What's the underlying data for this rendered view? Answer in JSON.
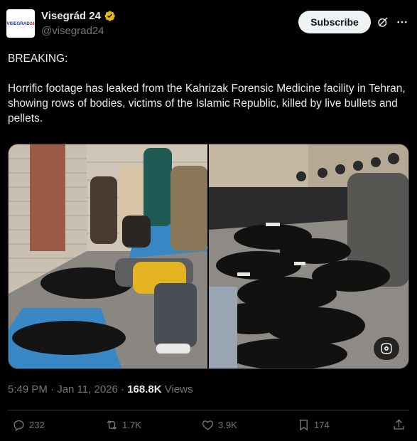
{
  "author": {
    "avatar_text_1": "VISEGRAD",
    "avatar_text_2": "24",
    "display_name": "Visegrád 24",
    "handle": "@visegrad24",
    "verified": true
  },
  "header": {
    "subscribe_label": "Subscribe",
    "grok_icon": "grok-icon",
    "more_icon": "more-icon"
  },
  "tweet": {
    "text": "BREAKING:\n\nHorrific footage has leaked from the Kahrizak Forensic Medicine facility in Tehran, showing rows of bodies, victims of the Islamic Republic, killed by live bullets and pellets."
  },
  "media": {
    "count": 2,
    "alt_badge_icon": "media-settings-icon"
  },
  "meta": {
    "time": "5:49 PM",
    "date": "Jan 11, 2026",
    "separator": "·",
    "views_count": "168.8K",
    "views_label": "Views"
  },
  "actions": {
    "replies": "232",
    "reposts": "1.7K",
    "likes": "3.9K",
    "bookmarks": "174"
  },
  "colors": {
    "background": "#000000",
    "text": "#e7e9ea",
    "muted": "#71767b",
    "verified_gold": "#e2b719",
    "border": "#2f3336"
  }
}
